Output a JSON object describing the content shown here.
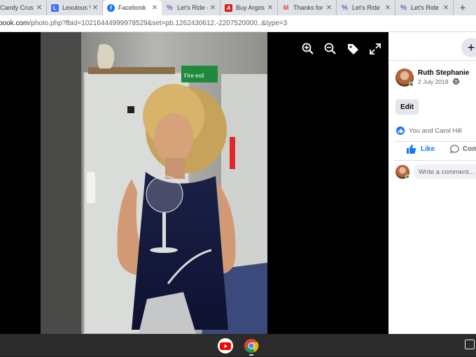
{
  "browser": {
    "tabs": [
      {
        "title": "Candy Crus",
        "favicon": "candy-crush-icon",
        "color": "#e8452f",
        "active": false
      },
      {
        "title": "Lexulous W",
        "favicon": "lexulous-icon",
        "color": "#4a6cf7",
        "letter": "L",
        "active": false
      },
      {
        "title": "Facebook",
        "favicon": "facebook-icon",
        "color": "#1877f2",
        "active": true
      },
      {
        "title": "Let's Ride -",
        "favicon": "letsride-icon",
        "color": "#7b5ea7",
        "active": false
      },
      {
        "title": "Buy Argos",
        "favicon": "argos-icon",
        "color": "#d42114",
        "letter": "A",
        "active": false
      },
      {
        "title": "Thanks for",
        "favicon": "gmail-icon",
        "color": "#ea4335",
        "letter": "M",
        "active": false
      },
      {
        "title": "Let's Ride",
        "favicon": "letsride-icon",
        "color": "#7b5ea7",
        "active": false
      },
      {
        "title": "Let's Ride",
        "favicon": "letsride-icon",
        "color": "#7b5ea7",
        "active": false
      }
    ],
    "new_tab_label": "+",
    "url_host": "book.com",
    "url_path": "/photo.php?fbid=10216444999978529&set=pb.1262430612.-2207520000..&type=3"
  },
  "viewer": {
    "controls": [
      "zoom-in-icon",
      "zoom-out-icon",
      "tag-icon",
      "fullscreen-icon"
    ],
    "sign_text": "Fire exit"
  },
  "post": {
    "author": "Ruth Stephanie",
    "date": "2 July 2018",
    "edit_label": "Edit",
    "reactions_text": "You and Carol Hill",
    "like_label": "Like",
    "comment_label": "Com",
    "comment_placeholder": "Write a comment...",
    "plus_label": "+"
  },
  "shelf": {
    "apps": [
      "youtube-icon",
      "chrome-icon"
    ]
  }
}
